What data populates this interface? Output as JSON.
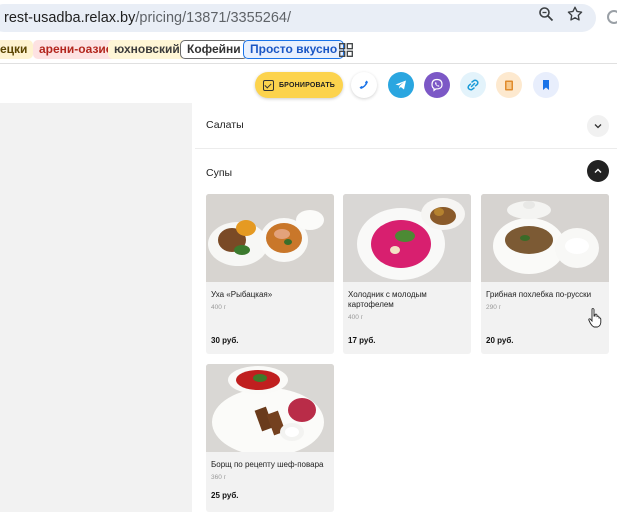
{
  "browser": {
    "url_host": "rest-usadba.relax.by",
    "url_path": "/pricing/13871/3355264/",
    "icons": [
      "zoom-icon",
      "star-icon",
      "extension-icon"
    ]
  },
  "bookmarks": [
    {
      "label": "ецки"
    },
    {
      "label": "арени-оазис"
    },
    {
      "label": "юхновский"
    },
    {
      "label": "Кофейни"
    },
    {
      "label": "Просто вкусно"
    }
  ],
  "toolbar": {
    "book_label": "БРОНИРОВАТЬ",
    "icons": [
      "phone-icon",
      "telegram-icon",
      "viber-icon",
      "link-icon",
      "menu-book-icon",
      "bookmark-icon"
    ],
    "colors": {
      "book": "#fcd34d",
      "telegram": "#2aa6e0",
      "viber": "#7c58c6"
    }
  },
  "sections": {
    "salads": {
      "title": "Салаты"
    },
    "soups": {
      "title": "Супы"
    }
  },
  "dishes": [
    {
      "name": "Уха «Рыбацкая»",
      "weight": "400 г",
      "price": "30 руб."
    },
    {
      "name": "Холодник с молодым картофелем",
      "weight": "400 г",
      "price": "17 руб."
    },
    {
      "name": "Грибная похлебка по-русски",
      "weight": "290 г",
      "price": "20 руб."
    },
    {
      "name": "Борщ по рецепту шеф-повара",
      "weight": "360 г",
      "price": "25 руб."
    }
  ]
}
